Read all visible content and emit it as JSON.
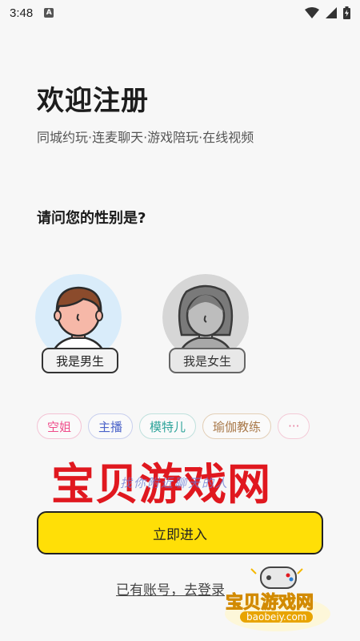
{
  "status_bar": {
    "time": "3:48",
    "notification_glyph": "A",
    "icons": [
      "wifi-icon",
      "signal-icon",
      "battery-icon"
    ]
  },
  "header": {
    "title": "欢迎注册",
    "subtitle": "同城约玩·连麦聊天·游戏陪玩·在线视频"
  },
  "question": "请问您的性别是?",
  "genders": [
    {
      "label": "我是男生",
      "avatar": "male-avatar-icon",
      "selected": true
    },
    {
      "label": "我是女生",
      "avatar": "female-avatar-icon",
      "selected": false
    }
  ],
  "tags": [
    "空姐",
    "主播",
    "模特儿",
    "瑜伽教练",
    "···"
  ],
  "watermark": {
    "big": "宝贝游戏网",
    "small": "找你附近聊天的人"
  },
  "submit_label": "立即进入",
  "login_link": "已有账号，去登录",
  "logo": {
    "text": "宝贝游戏网",
    "url": "baobeiy.com"
  },
  "colors": {
    "accent": "#ffdf07",
    "background": "#f7f7f7",
    "watermark": "#e0181f"
  }
}
